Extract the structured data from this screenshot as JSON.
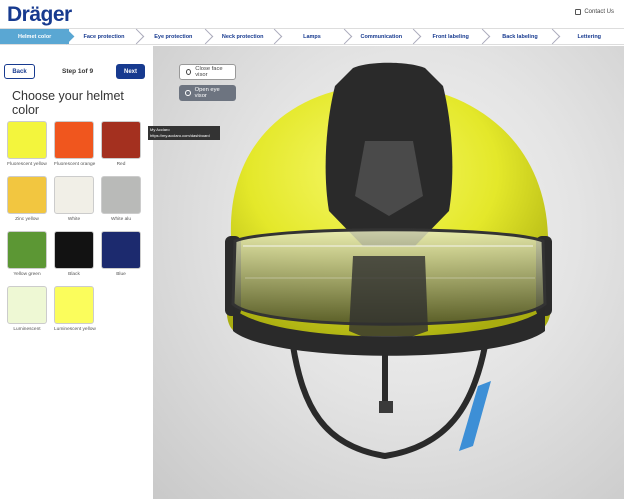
{
  "header": {
    "logo": "Dräger",
    "contact": "Contact Us"
  },
  "steps": [
    {
      "label": "Helmet color",
      "active": true
    },
    {
      "label": "Face protection",
      "active": false
    },
    {
      "label": "Eye protection",
      "active": false
    },
    {
      "label": "Neck protection",
      "active": false
    },
    {
      "label": "Lamps",
      "active": false
    },
    {
      "label": "Communication",
      "active": false
    },
    {
      "label": "Front labeling",
      "active": false
    },
    {
      "label": "Back labeling",
      "active": false
    },
    {
      "label": "Lettering",
      "active": false
    }
  ],
  "sidebar": {
    "back_label": "Back",
    "next_label": "Next",
    "step_text": "Step 1of 9",
    "title": "Choose your helmet color",
    "swatches": [
      {
        "label": "Fluorescent yellow",
        "color": "#f3f53d"
      },
      {
        "label": "Fluorescent orange",
        "color": "#f0561e"
      },
      {
        "label": "Red",
        "color": "#a4301f"
      },
      {
        "label": "Zinc yellow",
        "color": "#f2c640"
      },
      {
        "label": "White",
        "color": "#f1efe7"
      },
      {
        "label": "White alu",
        "color": "#b9bab8"
      },
      {
        "label": "Yellow green",
        "color": "#5c9734"
      },
      {
        "label": "Black",
        "color": "#121212"
      },
      {
        "label": "Blue",
        "color": "#1c2a6e"
      },
      {
        "label": "Luminescent",
        "color": "#eef8d4"
      },
      {
        "label": "Luminescent yellow",
        "color": "#fbfd5c"
      }
    ]
  },
  "viewer": {
    "close_visor_label": "Close face visor",
    "open_visor_label": "Open eye visor"
  },
  "tooltip": {
    "line1": "My Acclaro",
    "line2": "https://my.acclaro.com/dashboard"
  }
}
